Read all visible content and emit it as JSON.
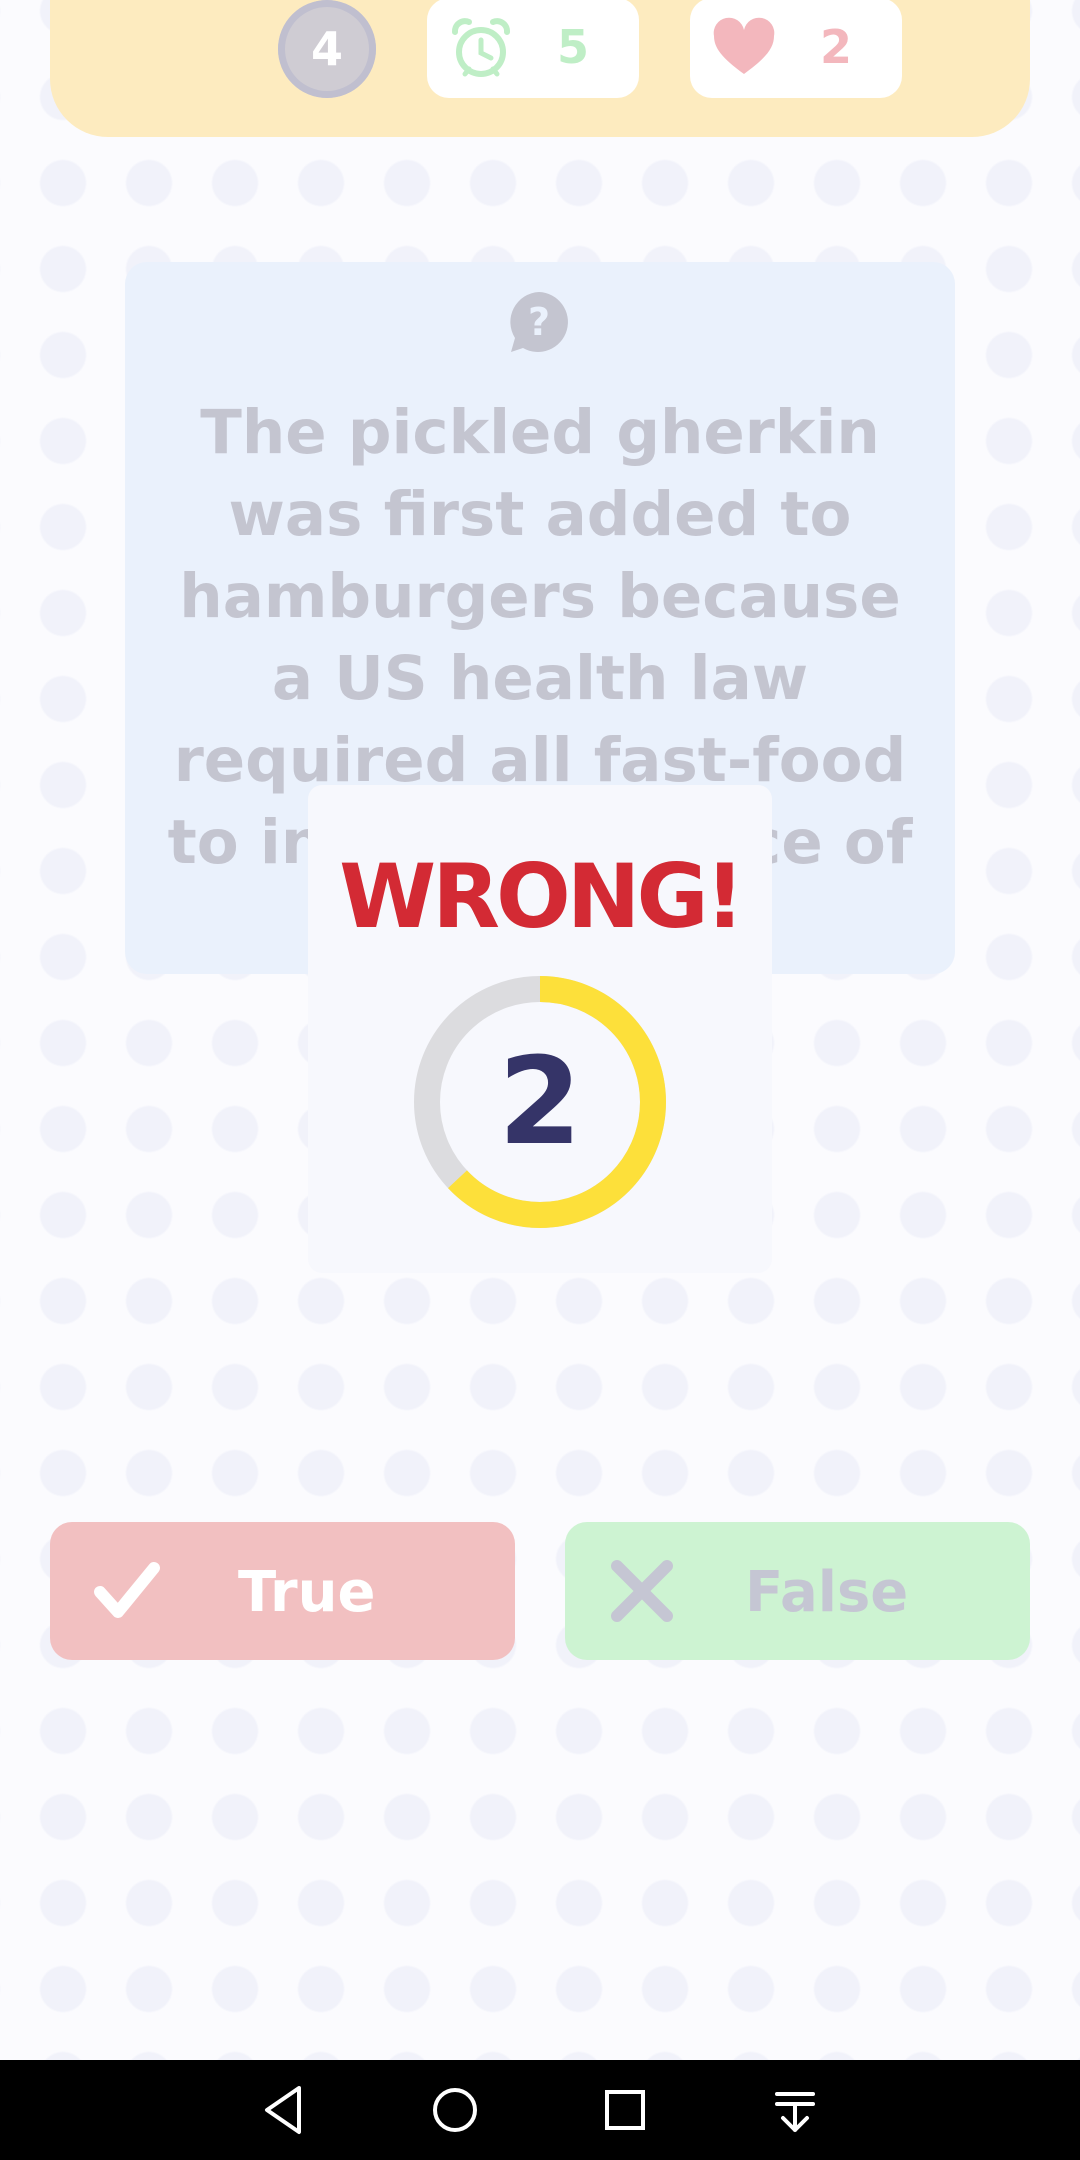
{
  "status_bar": {
    "level": "4",
    "timer_value": "5",
    "lives_value": "2"
  },
  "question": {
    "icon": "question-bubble-icon",
    "text": "The pickled gherkin was first added to hamburgers because a US health law required all fast-food to include a source of vitamin C."
  },
  "feedback": {
    "title": "WRONG!",
    "countdown": "2",
    "countdown_progress": 0.63
  },
  "answers": {
    "true_label": "True",
    "false_label": "False"
  },
  "colors": {
    "wrong": "#d32a34",
    "ring_fill": "#fde03a",
    "ring_track": "#dcdcdf",
    "true_bg": "#f2c0c1",
    "false_bg": "#cdf3d2",
    "topbar_bg": "#fdebbf"
  },
  "navigation": {
    "back": "back-icon",
    "home": "home-icon",
    "recents": "recents-icon",
    "extra": "download-menu-icon"
  }
}
